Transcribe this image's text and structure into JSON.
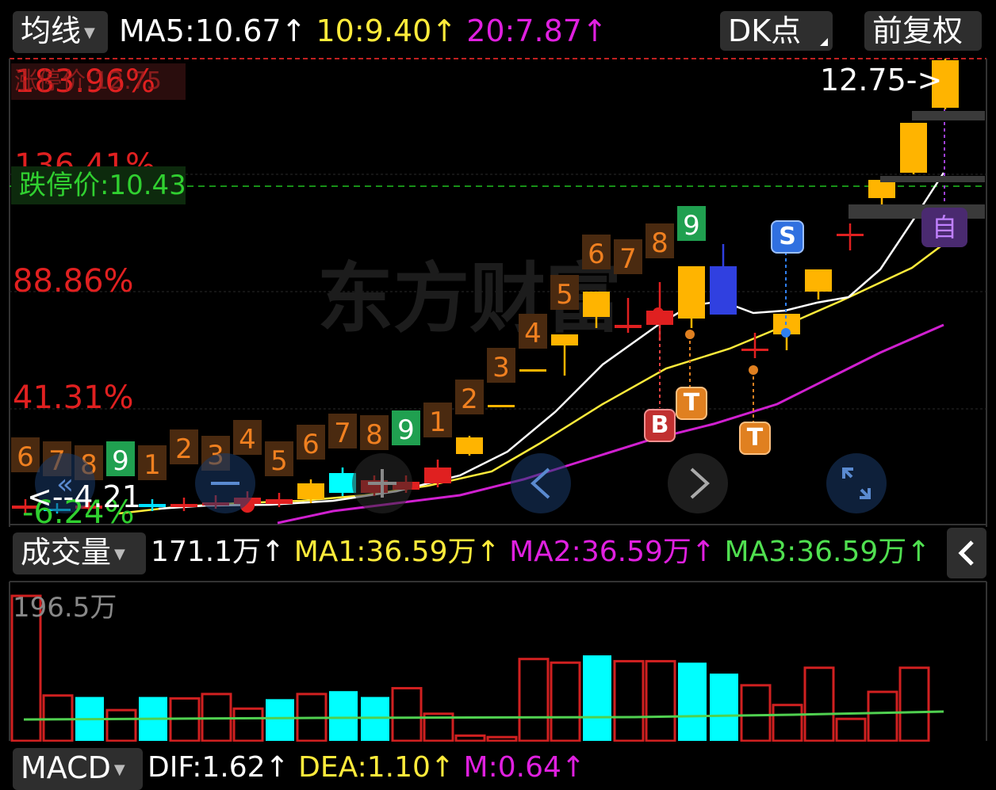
{
  "header": {
    "indicator_label": "均线",
    "ma5": "MA5:10.67↑",
    "ma10": "10:9.40↑",
    "ma20": "20:7.87↑",
    "dk_button": "DK点",
    "adjust_button": "前复权"
  },
  "price_panel": {
    "pct_top_overlap": "183.96%",
    "pct_top_overlap_2": "涨停价:12.75",
    "pct_136": "136.41%",
    "limit_down": "跌停价:10.43",
    "pct_88": "88.86%",
    "pct_41": "41.31%",
    "pct_low": "-6.24%",
    "low_price": "<--4.21",
    "high_price": "12.75->",
    "zi_badge": "自",
    "s_badge": "S",
    "b_badge": "B",
    "t_badge": "T",
    "watermark": "东方财富"
  },
  "volume_panel": {
    "label": "成交量",
    "vol": "171.1万↑",
    "ma1": "MA1:36.59万↑",
    "ma2": "MA2:36.59万↑",
    "ma3": "MA3:36.59万↑",
    "max_label": "196.5万"
  },
  "macd_panel": {
    "label": "MACD",
    "dif": "DIF:1.62↑",
    "dea": "DEA:1.10↑",
    "m": "M:0.64↑"
  },
  "colors": {
    "up": "#e02020",
    "down_cyan": "#00ffff",
    "ma5": "#ffffff",
    "ma10": "#ffeb3b",
    "ma20": "#e020e0",
    "ma3_vol": "#50e050",
    "candle_up": "#ffb400",
    "candle_blue": "#3040e0"
  },
  "chart_data": {
    "type": "candlestick",
    "td_counts": [
      "6",
      "7",
      "8",
      "9",
      "1",
      "2",
      "3",
      "4",
      "5",
      "6",
      "7",
      "8",
      "9",
      "1",
      "2",
      "3",
      "4",
      "5",
      "6",
      "7",
      "8",
      "9"
    ],
    "volume_values_wan": [
      196.5,
      60,
      58,
      40,
      58,
      56,
      62,
      42,
      55,
      62,
      66,
      58,
      70,
      35,
      5,
      3,
      110,
      105,
      115,
      107,
      107,
      105,
      90,
      74,
      47,
      98,
      28,
      65,
      98
    ],
    "volume_ma_wan": 36.59,
    "ylabel_max": "196.5万"
  }
}
